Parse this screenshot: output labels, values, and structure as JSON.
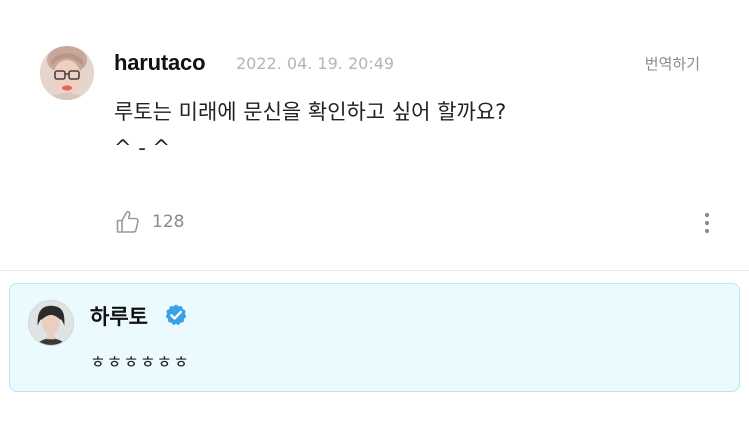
{
  "comment": {
    "username": "harutaco",
    "timestamp": "2022. 04. 19. 20:49",
    "translate_label": "번역하기",
    "body_lines": [
      "루토는 미래에 문신을 확인하고 싶어 할까요?",
      "^ - ^"
    ],
    "like_count": "128",
    "icons": {
      "like": "thumbs-up-icon",
      "more": "more-vertical-icon"
    }
  },
  "reply": {
    "name": "하루토",
    "text": "ㅎㅎㅎㅎㅎㅎ",
    "verified_icon": "verified-badge-icon",
    "colors": {
      "background": "#eafaff",
      "border": "#b7e6f4",
      "verified": "#3aa0e8"
    }
  }
}
